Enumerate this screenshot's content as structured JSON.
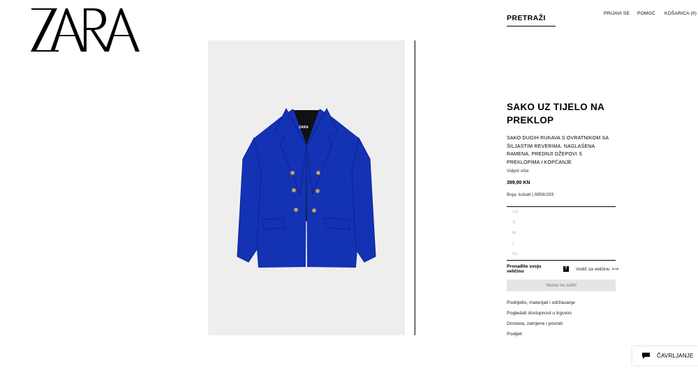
{
  "brand": {
    "logo_text": "ZARA"
  },
  "header": {
    "search_label": "PRETRAŽI",
    "nav": {
      "login": "PRIJAVI SE",
      "help": "POMOĆ",
      "cart": "KOŠARICA (0)"
    }
  },
  "product": {
    "title": "SAKO UZ TIJELO NA PREKLOP",
    "description": "SAKO DUGIH RUKAVA S OVRATNIKOM SA ŠILJASTIM REVERIMA. NAGLAŠENA RAMENA, PREDNJI DŽEPOVI S PREKLOPIMA I KOPČANJE",
    "see_more": "Vidjeti više",
    "price": "399,90 KN",
    "color_info": "Boja: kobalt | 8858/293",
    "image_color": "#1432b4",
    "sizes": [
      "XS",
      "S",
      "M",
      "L",
      "XL"
    ],
    "find_size": "Pronađite svoju veličinu",
    "find_size_badge": "?",
    "size_guide": "Vodič za veličinu",
    "stock_button": "Nema na zalihi",
    "links": [
      "Podrijetlo, materijali i održavanje",
      "Pogledati dostupnost u trgovini",
      "Dostava, zamjene i povrati",
      "Podijeli"
    ]
  },
  "chat": {
    "label": "ČAVRLJANJE"
  }
}
